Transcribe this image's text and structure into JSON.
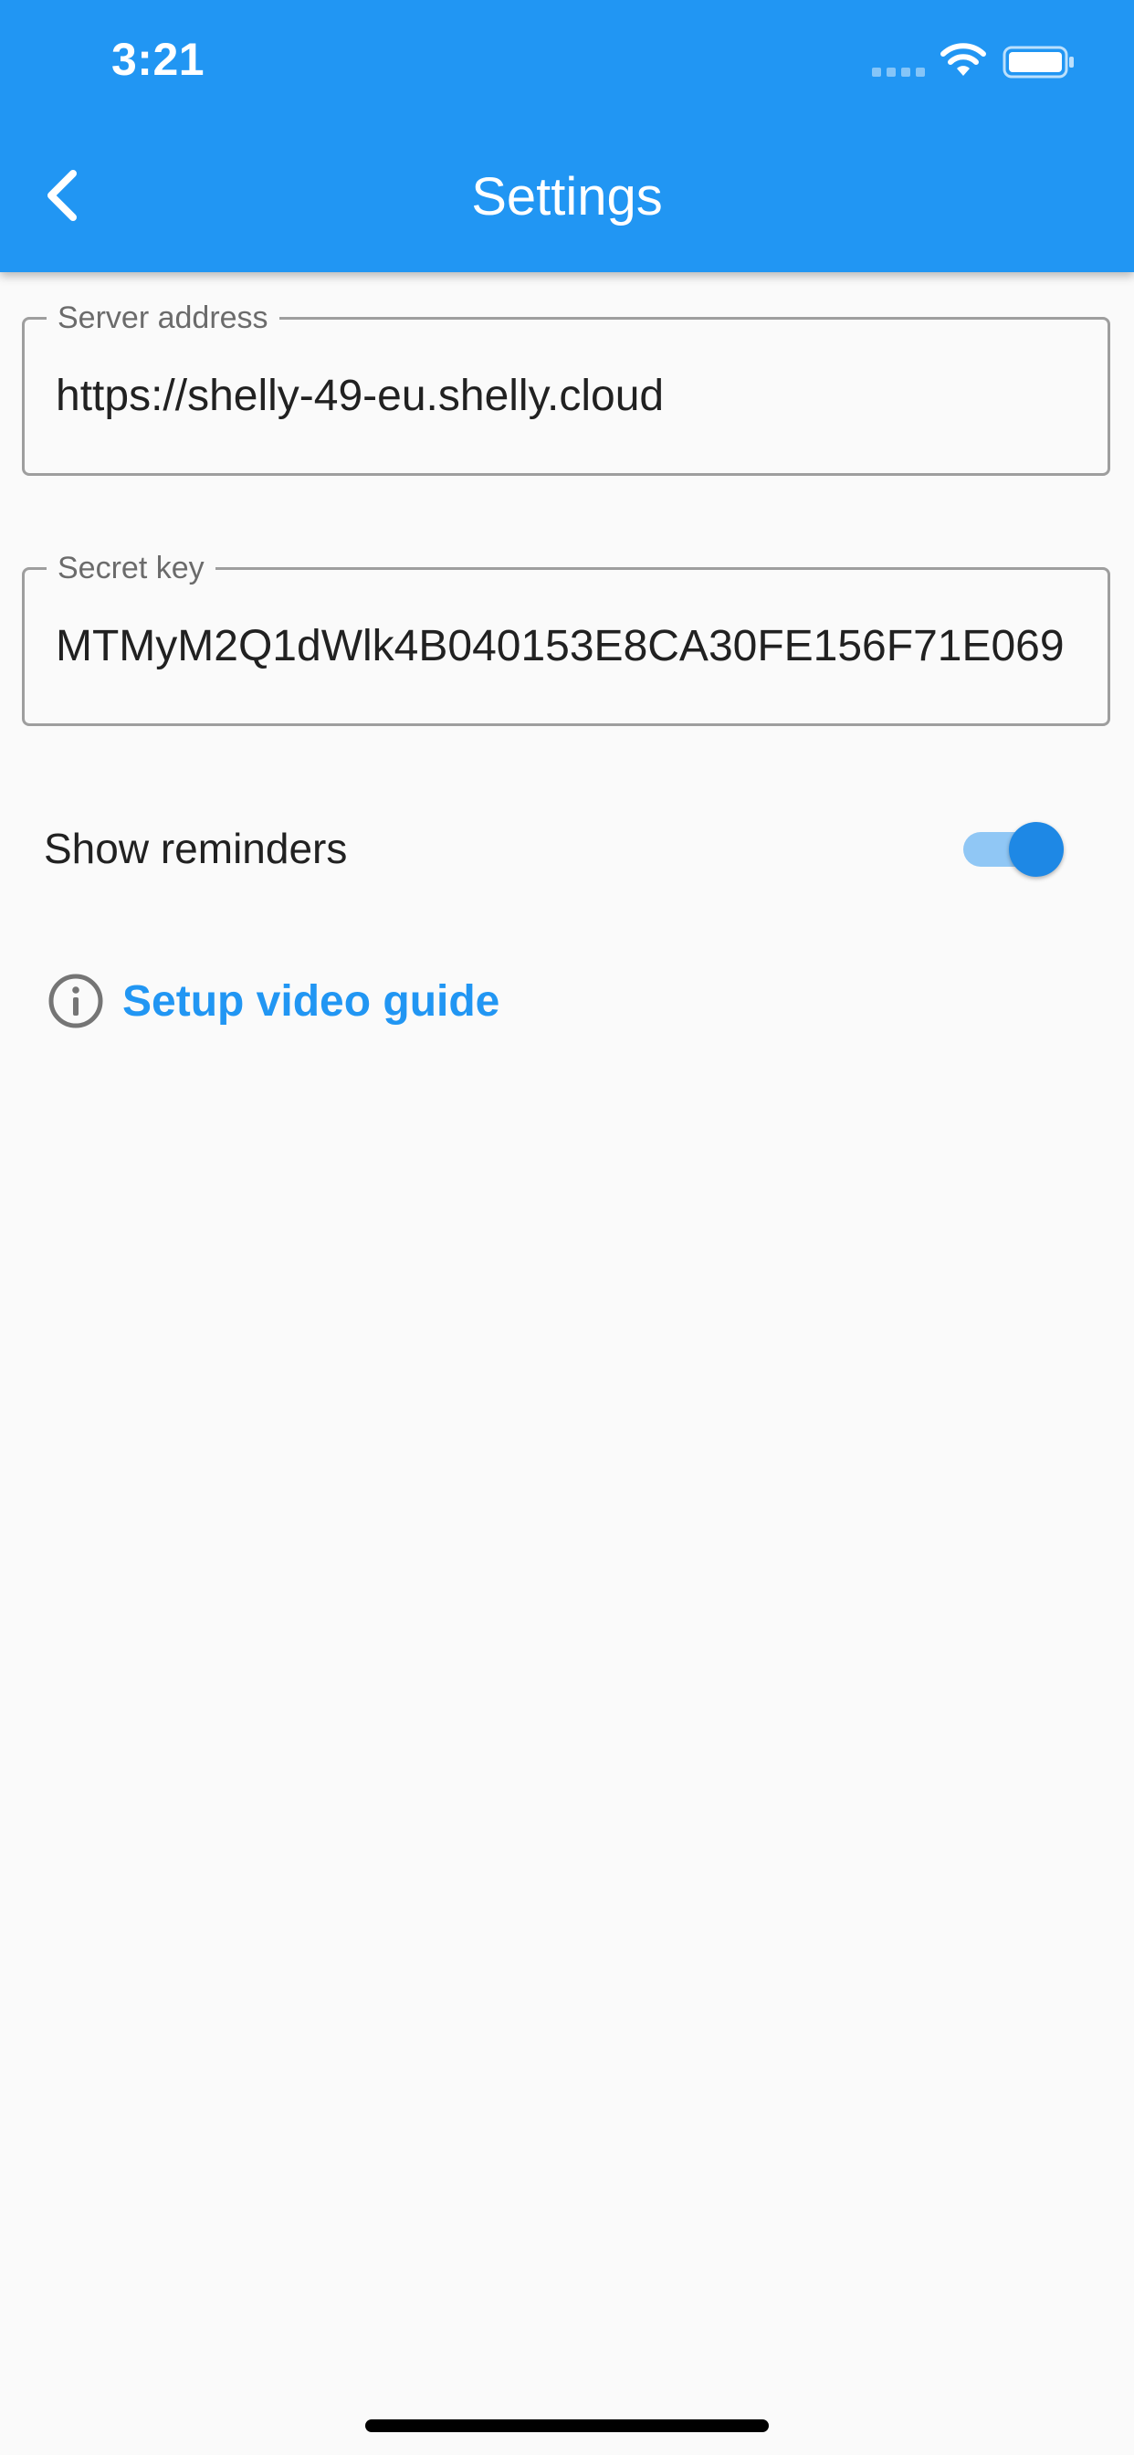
{
  "status_bar": {
    "time": "3:21"
  },
  "app_bar": {
    "title": "Settings",
    "back_icon": "chevron-left-icon",
    "color": "#2196f3"
  },
  "fields": {
    "server_address": {
      "label": "Server address",
      "value": "https://shelly-49-eu.shelly.cloud"
    },
    "secret_key": {
      "label": "Secret key",
      "value": "MTMyM2Q1dWlk4B040153E8CA30FE156F71E069"
    }
  },
  "reminders": {
    "label": "Show reminders",
    "enabled": true
  },
  "guide_link": {
    "label": "Setup video guide",
    "icon": "info-icon",
    "color": "#2196f3"
  }
}
